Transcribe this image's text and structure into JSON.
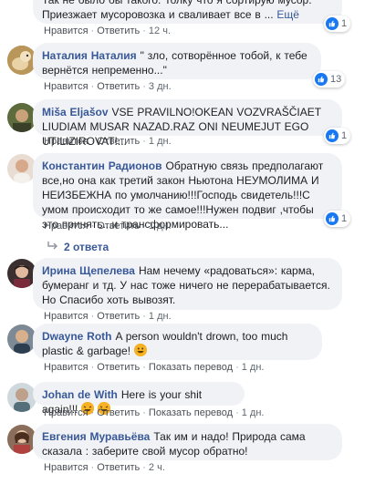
{
  "comments": [
    {
      "author": "",
      "text": "Так не было бы такого. Толку что я сортирую мусор. Приезжает мусоровозка и сваливает все в ...",
      "more": "Ещё",
      "like": "Нравится",
      "reply": "Ответить",
      "time": "12 ч.",
      "reactions": "1"
    },
    {
      "author": "Наталия Наталия",
      "text": "\" зло, сотворённое тобой, к тебе вернётся непременно...\"",
      "like": "Нравится",
      "reply": "Ответить",
      "time": "3 дн.",
      "reactions": "13"
    },
    {
      "author": "Miša Eljašov",
      "text": "VSE PRAVILNO!OKEAN VOZVRAŠČIAET LIUDIAM MUSAR NAZAD.RAZ ONI NEUMEJUT EGO UTILIZIROVAT!...",
      "like": "Нравится",
      "reply": "Ответить",
      "time": "1 дн.",
      "reactions": "1"
    },
    {
      "author": "Константин Радионов",
      "text": "Обратную связь предполагают все,но она как третий закон Ньютона НЕУМОЛИМА И НЕИЗБЕЖНА по умолчанию!!!Господь свидетель!!!С умом происходит то же самое!!!Нужен подвиг ,чтобы это принять...и трансформировать...",
      "like": "Нравится",
      "reply": "Ответить",
      "time": "1 дн.",
      "reactions": "1"
    },
    {
      "author": "Ирина Щепелева",
      "text": "Нам нечему «радоваться»: карма, бумеранг и тд. У нас тоже ничего не перерабатывается. Но Спасибо хоть вывозят.",
      "like": "Нравится",
      "reply": "Ответить",
      "time": "1 дн."
    },
    {
      "author": "Dwayne Roth",
      "text": "A person wouldn't drown, too much plastic & garbage!",
      "like": "Нравится",
      "reply": "Ответить",
      "translate": "Показать перевод",
      "time": "1 дн."
    },
    {
      "author": "Johan de With",
      "text": "Here is your shit again!!!",
      "like": "Нравится",
      "reply": "Ответить",
      "translate": "Показать перевод",
      "time": "1 дн."
    },
    {
      "author": "Евгения Муравьёва",
      "text": "Так им и надо! Природа сама сказала : заберите свой мусор обратно!",
      "like": "Нравится",
      "reply": "Ответить",
      "time": "2 ч."
    }
  ],
  "replies_toggle": "2 ответа",
  "colors": {
    "link": "#385898",
    "bubble": "#f0f2f5",
    "like_blue": "#1877f2"
  }
}
